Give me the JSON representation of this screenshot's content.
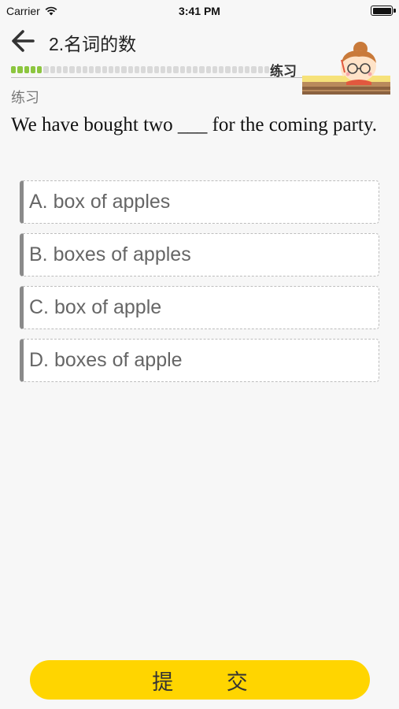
{
  "status_bar": {
    "carrier": "Carrier",
    "time": "3:41 PM"
  },
  "header": {
    "title": "2.名词的数",
    "practice_tag": "练习",
    "progress": {
      "completed": 5,
      "total": 40
    }
  },
  "section_label": "练习",
  "question": {
    "text": "We have bought two ___ for the coming party."
  },
  "options": [
    {
      "label": "A. box of apples"
    },
    {
      "label": "B. boxes of apples"
    },
    {
      "label": "C. box of apple"
    },
    {
      "label": "D. boxes of apple"
    }
  ],
  "submit_label": "提 交",
  "colors": {
    "accent": "#ffd500",
    "progress_done": "#8cc63f",
    "progress_remaining": "#d9d9d9",
    "background": "#f7f7f7"
  }
}
